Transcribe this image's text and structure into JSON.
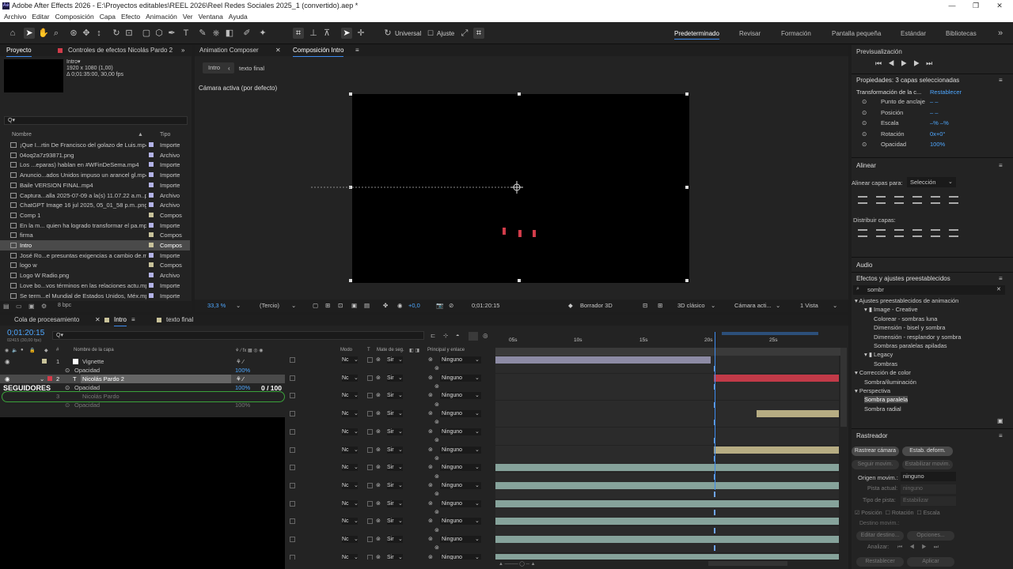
{
  "app": {
    "title": "Adobe After Effects 2026 - E:\\Proyectos editables\\REEL 2026\\Reel Redes Sociales 2025_1 (convertido).aep *",
    "icon": "Ae"
  },
  "menu": [
    "Archivo",
    "Editar",
    "Composición",
    "Capa",
    "Efecto",
    "Animación",
    "Ver",
    "Ventana",
    "Ayuda"
  ],
  "toolbar": {
    "universal_label": "Universal",
    "ajuste_label": "Ajuste",
    "workspaces": [
      "Predeterminado",
      "Revisar",
      "Formación",
      "Pantalla pequeña",
      "Estándar",
      "Bibliotecas"
    ]
  },
  "project": {
    "tab": "Proyecto",
    "effects_tab": "Controles de efectos Nicolás Pardo 2",
    "selected_name": "Intro▾",
    "selected_res": "1920 x 1080 (1,00)",
    "selected_dur": "Δ 0;01:35:00, 30,00 fps",
    "search_placeholder": "Q▾",
    "col_name": "Nombre",
    "col_type": "Tipo",
    "bpc": "8 bpc",
    "items": [
      {
        "name": "¡Que I...rtin De Francisco del golazo de Luis.mp4",
        "type": "Importe",
        "color": "#b3b3e8"
      },
      {
        "name": "04oq2a7z93871.png",
        "type": "Archivo",
        "color": "#b3b3e8"
      },
      {
        "name": "Los ...eparas) hablan en #WFinDeSema.mp4",
        "type": "Importe",
        "color": "#b3b3e8"
      },
      {
        "name": "Anuncio...ados Unidos impuso un arancel gl.mp4",
        "type": "Importe",
        "color": "#b3b3e8"
      },
      {
        "name": "Baile VERSION FINAL.mp4",
        "type": "Importe",
        "color": "#b3b3e8"
      },
      {
        "name": "Captura...alla 2025-07-09 a la(s) 11.07.22 a.m..png",
        "type": "Archivo",
        "color": "#b3b3e8"
      },
      {
        "name": "ChatGPT Image 16 jul 2025, 05_01_58 p.m..png",
        "type": "Archivo",
        "color": "#b3b3e8"
      },
      {
        "name": "Comp 1",
        "type": "Compos",
        "color": "#c9c39a"
      },
      {
        "name": "En la m... quien ha logrado transformar el pa.mp4",
        "type": "Importe",
        "color": "#b3b3e8"
      },
      {
        "name": "firma",
        "type": "Compos",
        "color": "#c9c39a"
      },
      {
        "name": "Intro",
        "type": "Compos",
        "color": "#c9c39a"
      },
      {
        "name": "José Ro...e presuntas exigencias a cambio de.mp4",
        "type": "Importe",
        "color": "#b3b3e8"
      },
      {
        "name": "logo w",
        "type": "Compos",
        "color": "#c9c39a"
      },
      {
        "name": "Logo W Radio.png",
        "type": "Archivo",
        "color": "#b3b3e8"
      },
      {
        "name": "Love bo...vos términos en las relaciones actu.mp4",
        "type": "Importe",
        "color": "#b3b3e8"
      },
      {
        "name": "Se term...el Mundial de Estados Unidos, Méx.mp4",
        "type": "Importe",
        "color": "#b3b3e8"
      }
    ]
  },
  "composition": {
    "tab1": "Animation Composer",
    "tab2": "Composición Intro",
    "crumb1": "Intro",
    "crumb2": "texto final",
    "camera_label": "Cámara activa (por defecto)",
    "zoom": "33,3 %",
    "res": "(Tercio)",
    "exposure": "+0,0",
    "timecode": "0;01:20:15",
    "renderer": "Borrador 3D",
    "view3d": "3D clásico",
    "camera": "Cámara acti...",
    "views": "1 Vista"
  },
  "timeline": {
    "tab_queue": "Cola de procesamiento",
    "tab_intro": "Intro",
    "tab_final": "texto final",
    "timecode": "0;01:20:15",
    "fps": "02415 (30,00 fps)",
    "search_placeholder": "Q▾",
    "col_layer": "Nombre de la capa",
    "col_mode": "Modo",
    "col_t": "T",
    "col_matte": "Mate de seg.",
    "col_parent": "Principal y enlace",
    "ruler": [
      "05s",
      "10s",
      "15s",
      "20s",
      "25s"
    ],
    "layer1": {
      "num": "1",
      "name": "Vignette",
      "prop": "Opacidad",
      "val": "100%"
    },
    "layer2": {
      "num": "2",
      "name": "Nicolás Pardo 2",
      "prop": "Opacidad",
      "val": "100%"
    },
    "layer3": {
      "num": "3",
      "name": "Nicolás Pardo",
      "prop": "Opacidad",
      "val": "100%"
    },
    "overlay_seguidores": "SEGUIDORES",
    "overlay_count": "0  / 100",
    "mode_value": "Nc",
    "matte_value": "Sir",
    "parent_value": "Ninguno"
  },
  "right": {
    "preview_title": "Previsualización",
    "props_title": "Propiedades: 3 capas seleccionadas",
    "transform": "Transformación de la c...",
    "reset": "Restablecer",
    "props": [
      {
        "label": "Punto de anclaje",
        "val": "–     –"
      },
      {
        "label": "Posición",
        "val": "–     –"
      },
      {
        "label": "Escala",
        "val": "–%   –%"
      },
      {
        "label": "Rotación",
        "val": "0x+0°"
      },
      {
        "label": "Opacidad",
        "val": "100%"
      }
    ],
    "align_title": "Alinear",
    "align_to_label": "Alinear capas para:",
    "align_to_value": "Selección",
    "distribute_label": "Distribuir capas:",
    "audio_title": "Audio",
    "effects_title": "Efectos y ajustes preestablecidos",
    "effects_search": "sombr",
    "tree": [
      {
        "label": "▾ Ajustes preestablecidos de animación",
        "indent": 0
      },
      {
        "label": "▾ ▮ Image - Creative",
        "indent": 1
      },
      {
        "label": "Colorear - sombras luna",
        "indent": 2
      },
      {
        "label": "Dimensión - bisel y sombra",
        "indent": 2
      },
      {
        "label": "Dimensión - resplandor y sombra",
        "indent": 2
      },
      {
        "label": "Sombras paralelas apiladas",
        "indent": 2
      },
      {
        "label": "▾ ▮ Legacy",
        "indent": 1
      },
      {
        "label": "Sombras",
        "indent": 2
      },
      {
        "label": "▾ Corrección de color",
        "indent": 0
      },
      {
        "label": "Sombra/iluminación",
        "indent": 1
      },
      {
        "label": "▾ Perspectiva",
        "indent": 0
      },
      {
        "label": "Sombra paralela",
        "indent": 1
      },
      {
        "label": "Sombra radial",
        "indent": 1
      }
    ],
    "tracker_title": "Rastreador",
    "track_camera": "Rastrear cámara",
    "warp_stab": "Estab. deform.",
    "track_motion": "Seguir movim.",
    "stab_motion": "Estabilizar movim.",
    "origin_label": "Origen movim.:",
    "origin_value": "ninguno",
    "track_current": "Pista actual:",
    "track_current_value": "ninguno",
    "track_type": "Tipo de pista:",
    "track_type_value": "Estabilizar",
    "position": "Posición",
    "rotation": "Rotación",
    "scale": "Escala",
    "target": "Destino movim.:",
    "edit_target": "Editar destino...",
    "options": "Opciones...",
    "analyze": "Analizar:",
    "apply": "Aplicar"
  }
}
